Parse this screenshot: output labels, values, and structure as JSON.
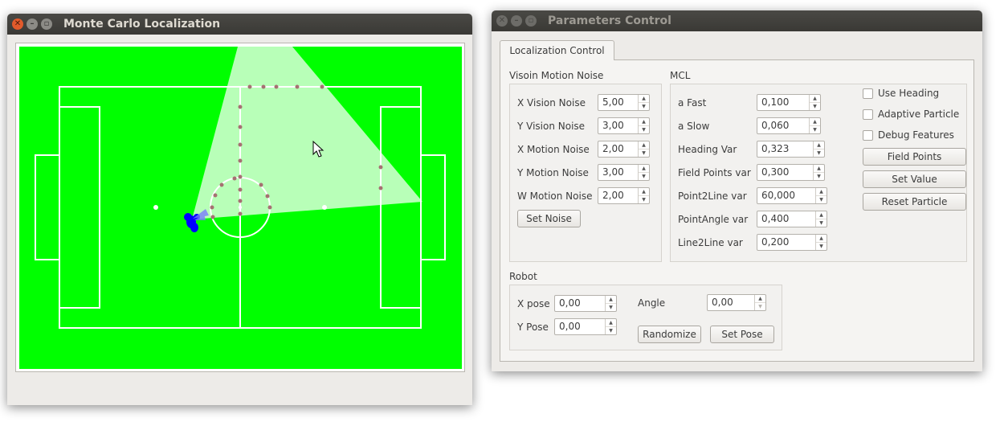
{
  "mcl_window": {
    "title": "Monte Carlo Localization",
    "colors": {
      "field": "#00ff00",
      "lines": "#ffffff",
      "particles": "#0000ff",
      "landmarks": "#a57171",
      "vision": "#c2ffc2"
    }
  },
  "params_window": {
    "title": "Parameters Control",
    "tab_label": "Localization Control",
    "vision_group": {
      "title": "Visoin Motion Noise",
      "fields": [
        {
          "label": "X Vision Noise",
          "value": "5,00"
        },
        {
          "label": "Y Vision Noise",
          "value": "3,00"
        },
        {
          "label": "X Motion Noise",
          "value": "2,00"
        },
        {
          "label": "Y Motion Noise",
          "value": "3,00"
        },
        {
          "label": "W Motion Noise",
          "value": "2,00"
        }
      ],
      "set_noise_label": "Set Noise"
    },
    "mcl_group": {
      "title": "MCL",
      "fields": [
        {
          "label": "a Fast",
          "value": "0,100"
        },
        {
          "label": "a Slow",
          "value": "0,060"
        },
        {
          "label": "Heading Var",
          "value": "0,323"
        },
        {
          "label": "Field Points var",
          "value": "0,300"
        },
        {
          "label": "Point2Line var",
          "value": "60,000"
        },
        {
          "label": "PointAngle var",
          "value": "0,400"
        },
        {
          "label": "Line2Line var",
          "value": "0,200"
        }
      ],
      "checkboxes": [
        {
          "label": "Use Heading",
          "checked": false
        },
        {
          "label": "Adaptive Particle",
          "checked": false
        },
        {
          "label": "Debug Features",
          "checked": false
        }
      ],
      "buttons": [
        "Field Points",
        "Set Value",
        "Reset Particle"
      ]
    },
    "robot_group": {
      "title": "Robot",
      "x_pose_label": "X pose",
      "x_pose_value": "0,00",
      "y_pose_label": "Y Pose",
      "y_pose_value": "0,00",
      "angle_label": "Angle",
      "angle_value": "0,00",
      "randomize_label": "Randomize",
      "set_pose_label": "Set Pose"
    }
  }
}
